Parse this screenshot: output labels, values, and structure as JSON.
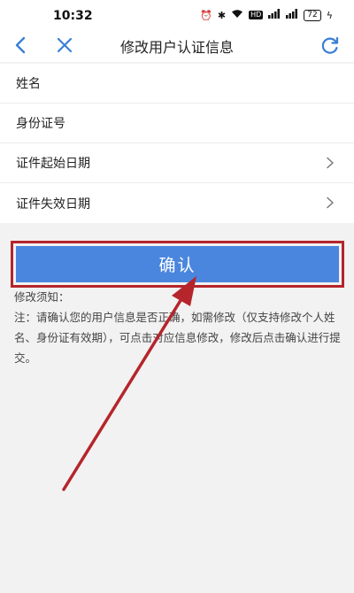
{
  "status_bar": {
    "time": "10:32",
    "icons": [
      "alarm-icon",
      "bluetooth-icon",
      "wifi-icon",
      "hd-icon",
      "signal-icon",
      "signal-icon",
      "battery-icon",
      "charging-icon"
    ],
    "hd_label": "HD",
    "battery_level": "72"
  },
  "nav": {
    "title": "修改用户认证信息",
    "back_icon": "chevron-left-icon",
    "close_icon": "close-icon",
    "refresh_icon": "refresh-icon",
    "accent_color": "#3a7fd5"
  },
  "form": {
    "rows": [
      {
        "label": "姓名",
        "value": "",
        "has_chevron": false
      },
      {
        "label": "身份证号",
        "value": "",
        "has_chevron": false
      },
      {
        "label": "证件起始日期",
        "value": "",
        "has_chevron": true
      },
      {
        "label": "证件失效日期",
        "value": "",
        "has_chevron": true
      }
    ]
  },
  "confirm": {
    "label": "确认",
    "button_color": "#4a86dd",
    "highlight_color": "#b5252b"
  },
  "notice": {
    "heading": "修改须知：",
    "body": "注：请确认您的用户信息是否正确，如需修改（仅支持修改个人姓名、身份证有效期），可点击对应信息修改，修改后点击确认进行提交。"
  },
  "annotation": {
    "arrow_color": "#b5252b"
  }
}
